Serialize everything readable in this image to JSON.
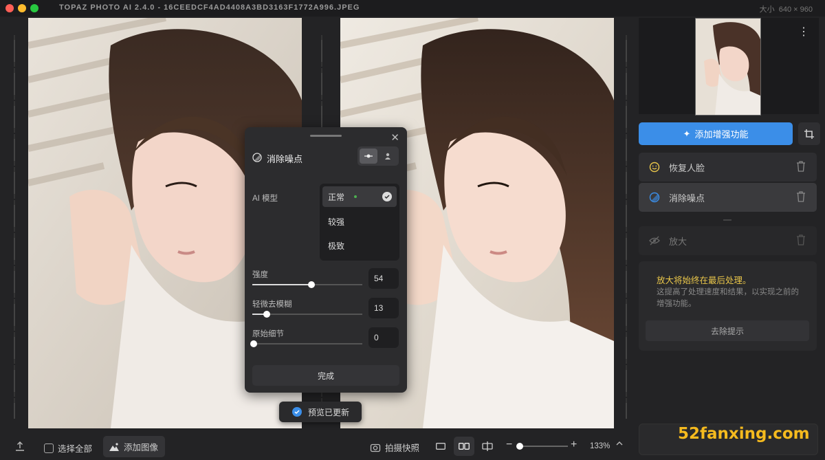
{
  "window": {
    "title": "TOPAZ PHOTO AI 2.4.0 - 16CEEDCF4AD4408A3BD3163F1772A996.JPEG",
    "size_label": "大小",
    "size_value": "640 × 960"
  },
  "right_panel": {
    "add_button": "添加增强功能",
    "features": [
      {
        "label": "恢复人脸",
        "icon": "smile-icon"
      },
      {
        "label": "消除噪点",
        "icon": "denoise-icon"
      },
      {
        "label": "放大",
        "icon": "eye-slash-icon"
      }
    ],
    "info": {
      "title": "放大将始终在最后处理。",
      "body": "这提高了处理速度和结果，以实现之前的增强功能。",
      "dismiss": "去除提示"
    }
  },
  "dialog": {
    "title": "消除噪点",
    "ai_model_label": "AI 模型",
    "models": [
      "正常",
      "较强",
      "极致"
    ],
    "selected_model": "正常",
    "sliders": [
      {
        "label": "强度",
        "value": "54",
        "fraction": 0.54
      },
      {
        "label": "轻微去模糊",
        "value": "13",
        "fraction": 0.13
      },
      {
        "label": "原始细节",
        "value": "0",
        "fraction": 0.0
      }
    ],
    "done": "完成"
  },
  "toast": "预览已更新",
  "bottom_bar": {
    "select_all": "选择全部",
    "add_image": "添加图像",
    "snapshot": "拍摄快照",
    "zoom_value": "133%",
    "zoom_fraction": 0.05
  },
  "watermark": "52fanxing.com",
  "colors": {
    "accent": "#3b8ee8",
    "warning_text": "#e9c64a",
    "watermark": "#f5ba1e"
  }
}
